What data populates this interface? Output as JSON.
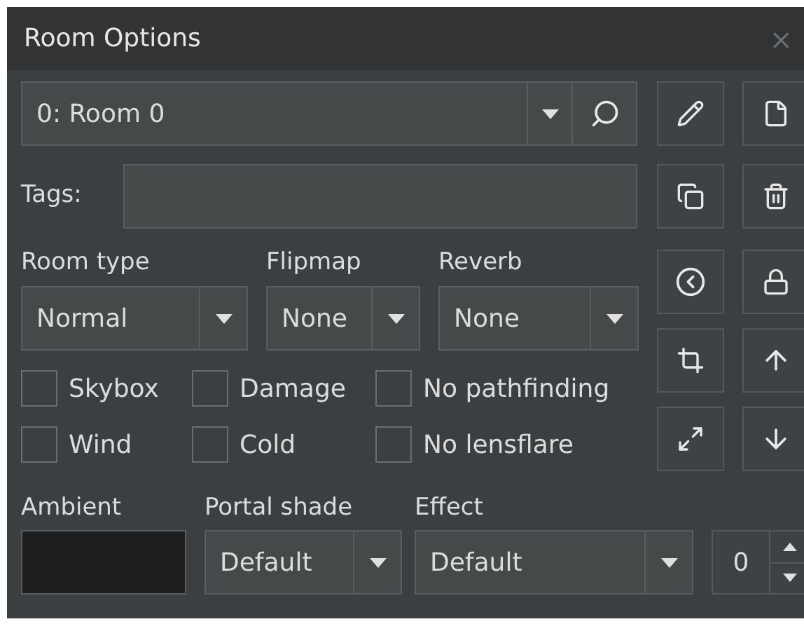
{
  "window": {
    "title": "Room Options",
    "close": "×"
  },
  "room_selector": {
    "value": "0: Room 0"
  },
  "tags": {
    "label": "Tags:"
  },
  "dropdowns": [
    {
      "label": "Room type",
      "value": "Normal"
    },
    {
      "label": "Flipmap",
      "value": "None"
    },
    {
      "label": "Reverb",
      "value": "None"
    }
  ],
  "checkboxes": [
    {
      "label": "Skybox",
      "checked": false
    },
    {
      "label": "Damage",
      "checked": false
    },
    {
      "label": "No pathfinding",
      "checked": false
    },
    {
      "label": "Wind",
      "checked": false
    },
    {
      "label": "Cold",
      "checked": false
    },
    {
      "label": "No lensflare",
      "checked": false
    }
  ],
  "ambient": {
    "label": "Ambient",
    "color": "#1e1e1e"
  },
  "portal_shade": {
    "label": "Portal shade",
    "value": "Default"
  },
  "effect": {
    "label": "Effect",
    "value": "Default",
    "amount": "0"
  }
}
